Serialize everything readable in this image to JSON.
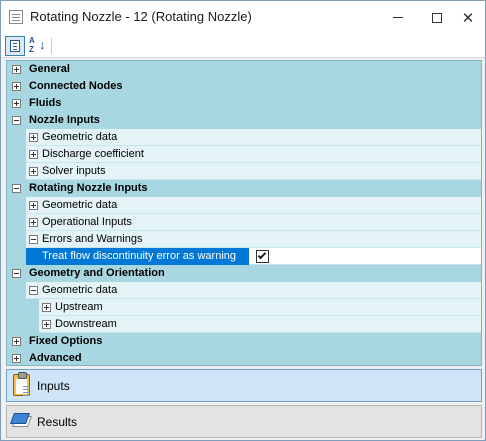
{
  "window": {
    "title": "Rotating Nozzle - 12 (Rotating Nozzle)",
    "icon": "property-sheet-icon"
  },
  "toolbar": {
    "categorized_icon": "categorized-view-icon",
    "alphabetical_icon": "sort-alphabetical-icon",
    "alpha_text": "A Z"
  },
  "tree": {
    "general": "General",
    "connected_nodes": "Connected Nodes",
    "fluids": "Fluids",
    "nozzle_inputs": "Nozzle Inputs",
    "nozzle_geometric_data": "Geometric data",
    "discharge_coefficient": "Discharge coefficient",
    "solver_inputs": "Solver inputs",
    "rotating_nozzle_inputs": "Rotating Nozzle Inputs",
    "rn_geometric_data": "Geometric data",
    "operational_inputs": "Operational Inputs",
    "errors_and_warnings": "Errors and Warnings",
    "treat_flow_label": "Treat flow discontinuity error as warning",
    "treat_flow_checked": true,
    "geometry_and_orientation": "Geometry and Orientation",
    "go_geometric_data": "Geometric data",
    "upstream": "Upstream",
    "downstream": "Downstream",
    "fixed_options": "Fixed Options",
    "advanced": "Advanced"
  },
  "panes": {
    "inputs": "Inputs",
    "results": "Results"
  },
  "colors": {
    "grid_background": "#a8d7e1",
    "selection": "#0078d7"
  }
}
